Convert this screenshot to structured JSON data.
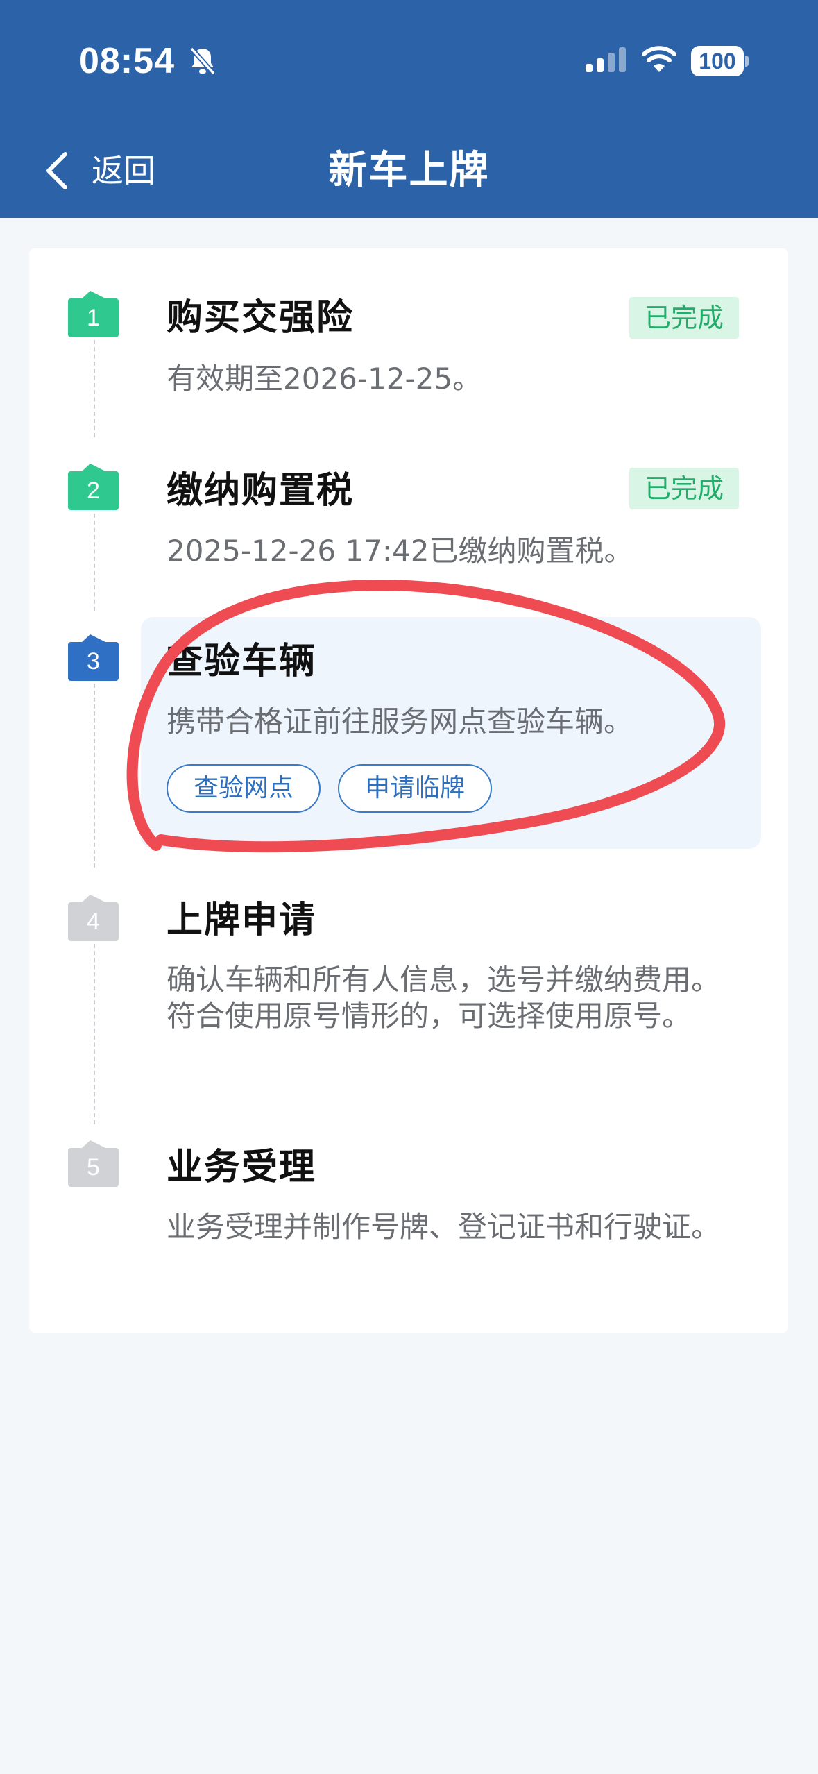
{
  "status_bar": {
    "time": "08:54",
    "battery": "100",
    "icons": [
      "bell-muted-icon",
      "signal-icon",
      "wifi-icon",
      "battery-icon"
    ]
  },
  "nav": {
    "back_label": "返回",
    "title": "新车上牌",
    "back_icon": "chevron-left-icon"
  },
  "steps": [
    {
      "number": "1",
      "title": "购买交强险",
      "desc": "有效期至2026-12-25。",
      "status": "已完成"
    },
    {
      "number": "2",
      "title": "缴纳购置税",
      "desc": "2025-12-26 17:42已缴纳购置税。",
      "status": "已完成"
    },
    {
      "number": "3",
      "title": "查验车辆",
      "desc": "携带合格证前往服务网点查验车辆。",
      "actions": [
        "查验网点",
        "申请临牌"
      ]
    },
    {
      "number": "4",
      "title": "上牌申请",
      "desc": "确认车辆和所有人信息，选号并缴纳费用。符合使用原号情形的，可选择使用原号。"
    },
    {
      "number": "5",
      "title": "业务受理",
      "desc": "业务受理并制作号牌、登记证书和行驶证。"
    }
  ],
  "colors": {
    "header_bg": "#2c63a8",
    "done_green": "#2fc88e",
    "active_blue": "#2f6fc4",
    "pending_gray": "#d0d2d5",
    "done_badge_bg": "#d9f5e6",
    "done_badge_text": "#22ad6b",
    "annotation_red": "#ef4b52"
  }
}
